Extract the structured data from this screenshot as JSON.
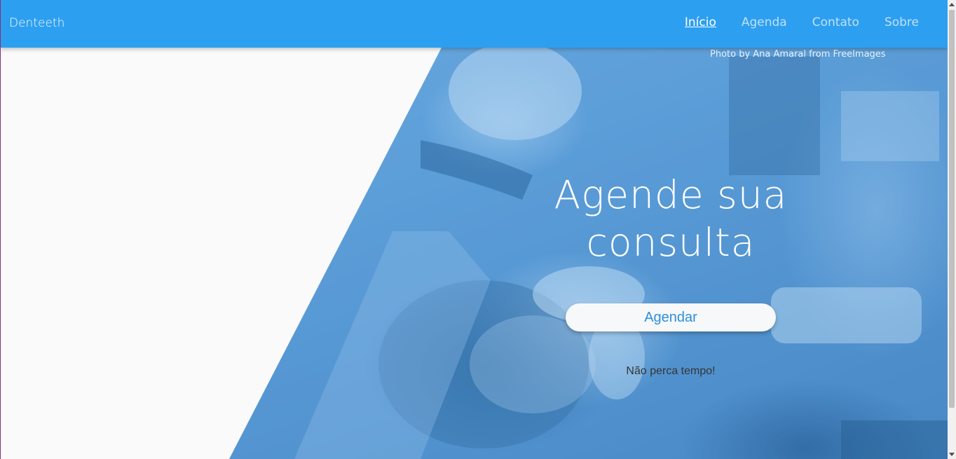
{
  "navbar": {
    "brand": "Denteeth",
    "links": [
      "Início",
      "Agenda",
      "Contato",
      "Sobre"
    ],
    "active": "Início",
    "color": "#2d9ff0"
  },
  "hero": {
    "credit": "Photo by Ana Amaral from FreeImages",
    "title_line1": "Agende sua",
    "title_line2": "consulta",
    "cta_label": "Agendar",
    "tagline": "Não perca tempo!",
    "overlay_color": "#2e96e6"
  }
}
